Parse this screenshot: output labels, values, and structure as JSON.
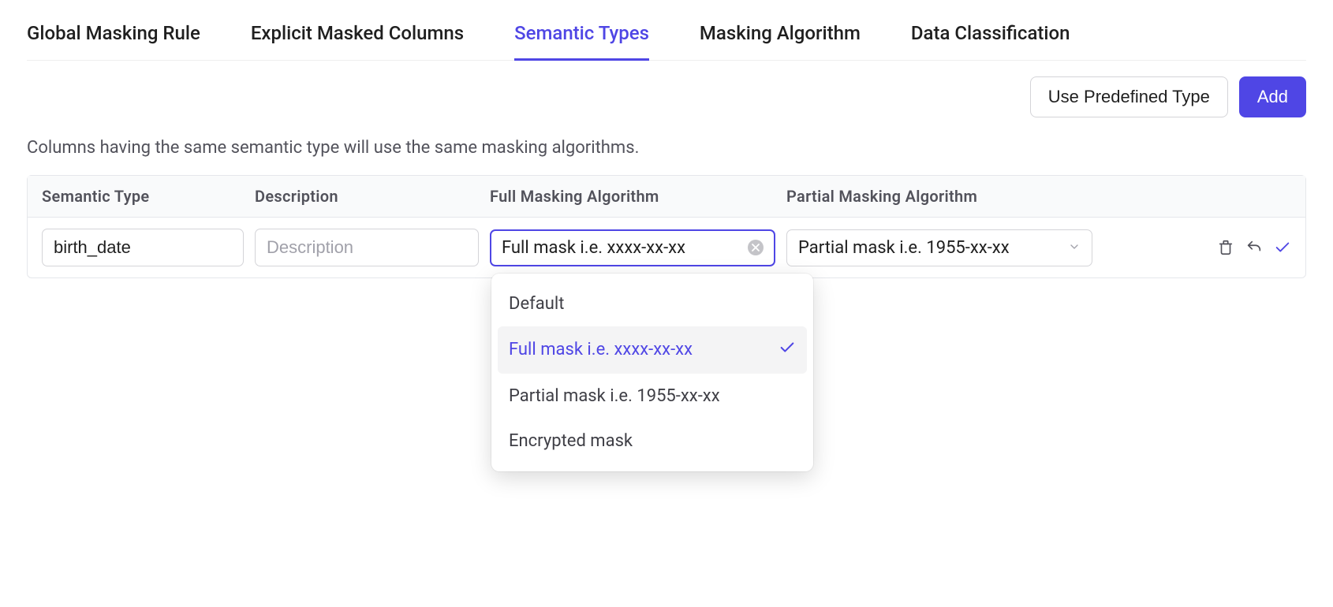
{
  "tabs": [
    {
      "label": "Global Masking Rule",
      "active": false
    },
    {
      "label": "Explicit Masked Columns",
      "active": false
    },
    {
      "label": "Semantic Types",
      "active": true
    },
    {
      "label": "Masking Algorithm",
      "active": false
    },
    {
      "label": "Data Classification",
      "active": false
    }
  ],
  "actions": {
    "predefined": "Use Predefined Type",
    "add": "Add"
  },
  "description": "Columns having the same semantic type will use the same masking algorithms.",
  "headers": {
    "semantic": "Semantic Type",
    "desc": "Description",
    "full": "Full Masking Algorithm",
    "partial": "Partial Masking Algorithm"
  },
  "row": {
    "semantic_value": "birth_date",
    "desc_value": "",
    "desc_placeholder": "Description",
    "full_selected": "Full mask i.e. xxxx-xx-xx",
    "partial_selected": "Partial mask i.e. 1955-xx-xx"
  },
  "dropdown": {
    "options": [
      {
        "label": "Default",
        "selected": false
      },
      {
        "label": "Full mask i.e. xxxx-xx-xx",
        "selected": true
      },
      {
        "label": "Partial mask i.e. 1955-xx-xx",
        "selected": false
      },
      {
        "label": "Encrypted mask",
        "selected": false
      }
    ]
  }
}
